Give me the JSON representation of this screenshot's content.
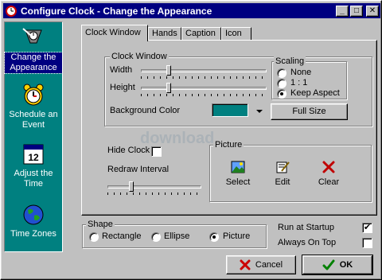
{
  "window": {
    "title": "Configure Clock - Change the Appearance",
    "controls": {
      "minimize": "_",
      "maximize": "□",
      "close": "✕"
    }
  },
  "sidebar": {
    "items": [
      {
        "label": "Change the Appearance",
        "icon": "appearance-clock-icon",
        "active": true
      },
      {
        "label": "Schedule an Event",
        "icon": "alarm-clock-icon",
        "active": false
      },
      {
        "label": "Adjust the Time",
        "icon": "calendar-12-icon",
        "active": false
      },
      {
        "label": "Time Zones",
        "icon": "globe-icon",
        "active": false
      }
    ]
  },
  "tabs": [
    {
      "label": "Clock Window",
      "selected": true
    },
    {
      "label": "Hands",
      "selected": false
    },
    {
      "label": "Caption",
      "selected": false
    },
    {
      "label": "Icon",
      "selected": false
    }
  ],
  "clock_window_group": {
    "title": "Clock Window",
    "width_label": "Width",
    "height_label": "Height",
    "background_color_label": "Background Color",
    "background_color": "#008080",
    "width_slider_value": 0.2,
    "height_slider_value": 0.2
  },
  "scaling_group": {
    "title": "Scaling",
    "options": [
      "None",
      "1 : 1",
      "Keep Aspect"
    ],
    "selected": "Keep Aspect"
  },
  "full_size_button": "Full Size",
  "hide_clock_label": "Hide Clock",
  "hide_clock_checked": false,
  "redraw_interval_label": "Redraw Interval",
  "redraw_slider_value": 0.25,
  "picture_group": {
    "title": "Picture",
    "buttons": [
      {
        "label": "Select",
        "icon": "picture-icon"
      },
      {
        "label": "Edit",
        "icon": "edit-icon"
      },
      {
        "label": "Clear",
        "icon": "clear-x-icon"
      }
    ]
  },
  "watermark": "download",
  "shape_group": {
    "title": "Shape",
    "options": [
      "Rectangle",
      "Ellipse",
      "Picture"
    ],
    "selected": "Picture"
  },
  "run_at_startup": {
    "label": "Run at Startup",
    "checked": true
  },
  "always_on_top": {
    "label": "Always On Top",
    "checked": false
  },
  "footer": {
    "cancel_label": "Cancel",
    "ok_label": "OK"
  },
  "colors": {
    "titlebar": "#000080",
    "sidebar": "#008080",
    "face": "#c0c0c0",
    "cancel_x": "#cc0000",
    "ok_check": "#008000"
  }
}
